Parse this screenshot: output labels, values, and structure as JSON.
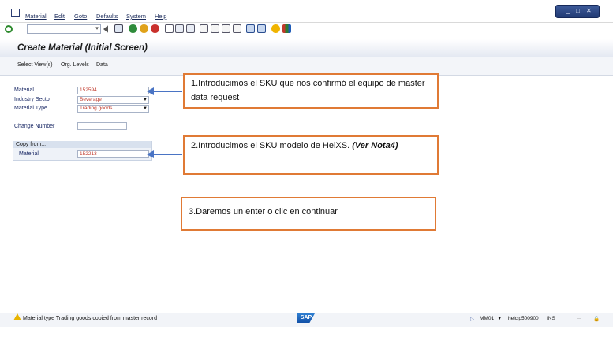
{
  "menu": [
    "Material",
    "Edit",
    "Goto",
    "Defaults",
    "System",
    "Help"
  ],
  "window_controls": {
    "min": "_",
    "max": "□",
    "close": "✕"
  },
  "title": "Create Material (Initial Screen)",
  "app_toolbar": [
    "Select View(s)",
    "Org. Levels",
    "Data"
  ],
  "form": {
    "material_label": "Material",
    "material_value": "152594",
    "industry_label": "Industry Sector",
    "industry_value": "Beverage",
    "type_label": "Material Type",
    "type_value": "Trading goods",
    "change_label": "Change Number",
    "change_value": "",
    "copy_header": "Copy from...",
    "copy_material_label": "Material",
    "copy_material_value": "152213"
  },
  "callouts": {
    "c1": "1.Introducimos el SKU que nos confirmó el equipo de master data request",
    "c2_text": "2.Introducimos el SKU modelo de HeiXS. ",
    "c2_note": "(Ver Nota4)",
    "c3": "3.Daremos un enter o clic en continuar"
  },
  "status": {
    "message": "Material type Trading goods copied from master record",
    "sap_logo": "SAP",
    "transaction": "MM01",
    "server": "heiclp500900",
    "mode": "INS"
  }
}
